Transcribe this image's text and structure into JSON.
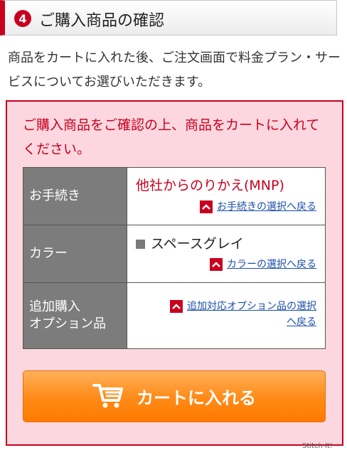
{
  "header": {
    "step_number": "4",
    "title": "ご購入商品の確認"
  },
  "intro": "商品をカートに入れた後、ご注文画面で料金プラン・サービスについてお選びいただきます。",
  "confirm_box": {
    "message": "ご購入商品をご確認の上、商品をカートに入れてください。",
    "rows": [
      {
        "label": "お手続き",
        "value": "他社からのりかえ(MNP)",
        "link": "お手続きの選択へ戻る"
      },
      {
        "label": "カラー",
        "value": "スペースグレイ",
        "link": "カラーの選択へ戻る"
      },
      {
        "label": "追加購入\nオプション品",
        "link_line1": "追加対応オプション品の選択",
        "link_line2": "へ戻る"
      }
    ],
    "cart_button": "カートに入れる"
  },
  "watermark": "Stitch It!"
}
